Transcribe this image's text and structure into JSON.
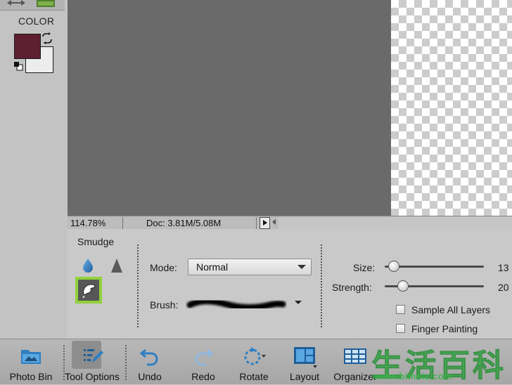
{
  "color_panel": {
    "label": "COLOR",
    "foreground_color": "#5e1f31",
    "background_color": "#ededed",
    "icons": [
      "swap-colors-icon",
      "default-colors-icon"
    ]
  },
  "status_bar": {
    "zoom": "114.78%",
    "doc_info": "Doc: 3.81M/5.08M"
  },
  "tool_options": {
    "tool_name": "Smudge",
    "tools": [
      "blur-tool-icon",
      "sharpen-tool-icon",
      "smudge-tool-icon"
    ],
    "active_tool": "Smudge",
    "mode_label": "Mode:",
    "mode_value": "Normal",
    "brush_label": "Brush:",
    "size_label": "Size:",
    "size_value": "13",
    "strength_label": "Strength:",
    "strength_value": "20",
    "sample_all_layers": {
      "label": "Sample All Layers",
      "checked": false
    },
    "finger_painting": {
      "label": "Finger Painting",
      "checked": false
    }
  },
  "taskbar": {
    "photo_bin": "Photo Bin",
    "tool_options": "Tool Options",
    "undo": "Undo",
    "redo": "Redo",
    "rotate": "Rotate",
    "layout": "Layout",
    "organizer": "Organizer"
  },
  "watermark": {
    "chars": "生活百科",
    "url": "www.bimeiz.com"
  },
  "colors": {
    "canvas_bg": "#6a6a6a",
    "panel_bg": "#c9c9c9",
    "highlight": "#92d13a"
  }
}
